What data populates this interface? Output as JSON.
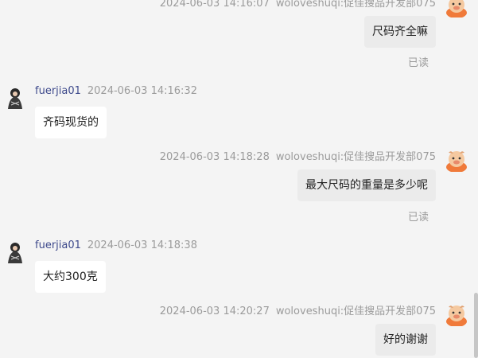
{
  "messages": [
    {
      "direction": "out",
      "timestamp": "2024-06-03 14:16:07",
      "sender": "woloveshuqi:促佳搜品开发部075",
      "text": "尺码齐全嘛",
      "read_label": "已读"
    },
    {
      "direction": "in",
      "timestamp": "2024-06-03 14:16:32",
      "sender": "fuerjia01",
      "text": "齐码现货的"
    },
    {
      "direction": "out",
      "timestamp": "2024-06-03 14:18:28",
      "sender": "woloveshuqi:促佳搜品开发部075",
      "text": "最大尺码的重量是多少呢",
      "read_label": "已读"
    },
    {
      "direction": "in",
      "timestamp": "2024-06-03 14:18:38",
      "sender": "fuerjia01",
      "text": "大约300克"
    },
    {
      "direction": "out",
      "timestamp": "2024-06-03 14:20:27",
      "sender": "woloveshuqi:促佳搜品开发部075",
      "text": "好的谢谢"
    }
  ],
  "colors": {
    "background": "#f4f4f4",
    "incoming_bubble": "#ffffff",
    "outgoing_bubble": "#ebebeb",
    "sender_name": "#3e4a8c",
    "meta_text": "#9b9b9b"
  }
}
